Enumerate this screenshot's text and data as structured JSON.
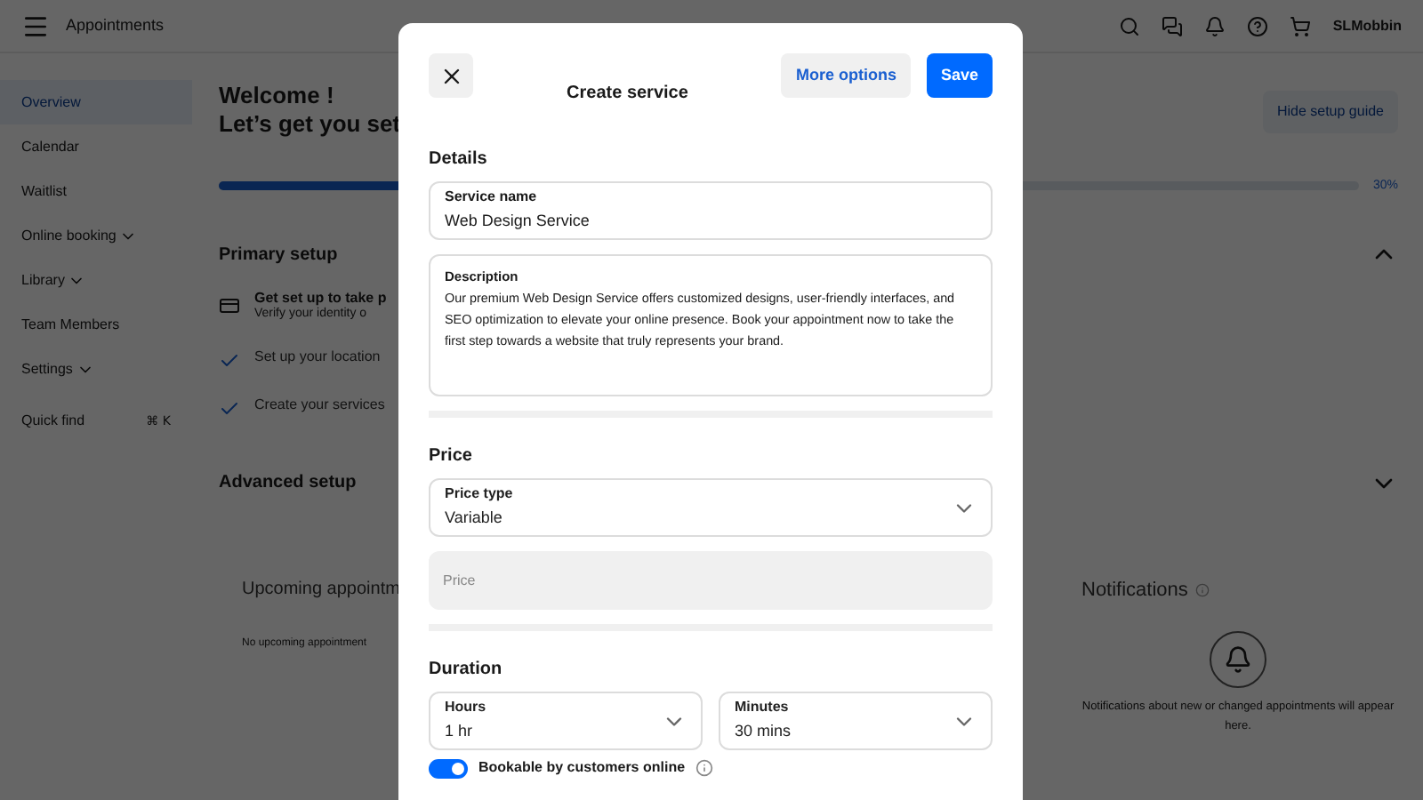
{
  "header": {
    "title": "Appointments",
    "user": "SLMobbin"
  },
  "sidebar": {
    "items": [
      {
        "label": "Overview",
        "selected": true,
        "expandable": false
      },
      {
        "label": "Calendar",
        "selected": false,
        "expandable": false
      },
      {
        "label": "Waitlist",
        "selected": false,
        "expandable": false
      },
      {
        "label": "Online booking",
        "selected": false,
        "expandable": true
      },
      {
        "label": "Library",
        "selected": false,
        "expandable": true
      },
      {
        "label": "Team Members",
        "selected": false,
        "expandable": false
      },
      {
        "label": "Settings",
        "selected": false,
        "expandable": true
      }
    ],
    "quick_find": {
      "label": "Quick find",
      "shortcut": "⌘ K"
    }
  },
  "main": {
    "welcome": "Welcome !",
    "subtitle": "Let’s get you set",
    "hide_button": "Hide setup guide",
    "progress": {
      "level": 0.3,
      "reading": "30%"
    },
    "primary_setup": {
      "title": "Primary setup",
      "expanded": true,
      "tasks": [
        {
          "title": "Get set up to take p",
          "subtitle": "Verify your identity o",
          "done": false
        },
        {
          "title": "Set up your location",
          "done": true
        },
        {
          "title": "Create your services",
          "done": true
        }
      ]
    },
    "advanced_setup": {
      "title": "Advanced setup",
      "expanded": false
    },
    "upcoming": {
      "title": "Upcoming appointm",
      "empty": "No upcoming appointment"
    },
    "notifications": {
      "title": "Notifications",
      "empty": "Notifications about new or changed appointments will appear here."
    }
  },
  "modal": {
    "title": "Create service",
    "more_options": "More options",
    "save": "Save",
    "details": {
      "heading": "Details",
      "service_name": {
        "label": "Service name",
        "value": "Web Design Service"
      },
      "description": {
        "label": "Description",
        "value": "Our premium Web Design Service offers customized designs, user-friendly interfaces, and SEO optimization to elevate your online presence. Book your appointment now to take the first step towards a website that truly represents your brand."
      }
    },
    "price": {
      "heading": "Price",
      "price_type": {
        "label": "Price type",
        "value": "Variable"
      },
      "price": {
        "placeholder": "Price",
        "disabled": true
      }
    },
    "duration": {
      "heading": "Duration",
      "hours": {
        "label": "Hours",
        "value": "1 hr"
      },
      "minutes": {
        "label": "Minutes",
        "value": "30 mins"
      }
    },
    "bookable": {
      "label": "Bookable by customers online",
      "on": true
    }
  }
}
